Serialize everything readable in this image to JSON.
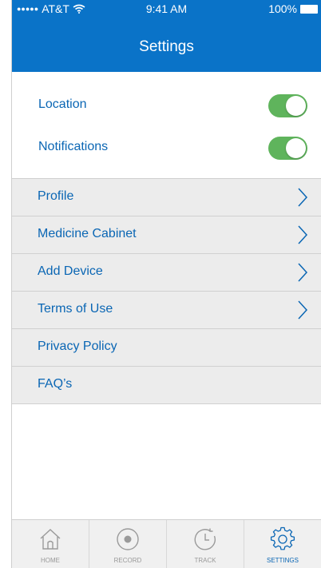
{
  "status_bar": {
    "signal": "●●●●●",
    "carrier": "AT&T",
    "time": "9:41 AM",
    "battery": "100%"
  },
  "header": {
    "title": "Settings"
  },
  "toggles": [
    {
      "label": "Location",
      "on": true
    },
    {
      "label": "Notifications",
      "on": true
    }
  ],
  "menu": [
    {
      "label": "Profile",
      "chevron": true
    },
    {
      "label": "Medicine Cabinet",
      "chevron": true
    },
    {
      "label": "Add Device",
      "chevron": true
    },
    {
      "label": "Terms of Use",
      "chevron": true
    },
    {
      "label": "Privacy Policy",
      "chevron": false
    },
    {
      "label": "FAQ’s",
      "chevron": false
    }
  ],
  "tabs": [
    {
      "label": "HOME",
      "icon": "home-icon",
      "active": false
    },
    {
      "label": "RECORD",
      "icon": "record-icon",
      "active": false
    },
    {
      "label": "TRACK",
      "icon": "clock-icon",
      "active": false
    },
    {
      "label": "SETTINGS",
      "icon": "gear-icon",
      "active": true
    }
  ],
  "colors": {
    "brand_blue": "#0a73c8",
    "link_blue": "#0a66b4",
    "toggle_green": "#5fb45c",
    "list_bg": "#ececec",
    "tab_inactive": "#999999"
  }
}
